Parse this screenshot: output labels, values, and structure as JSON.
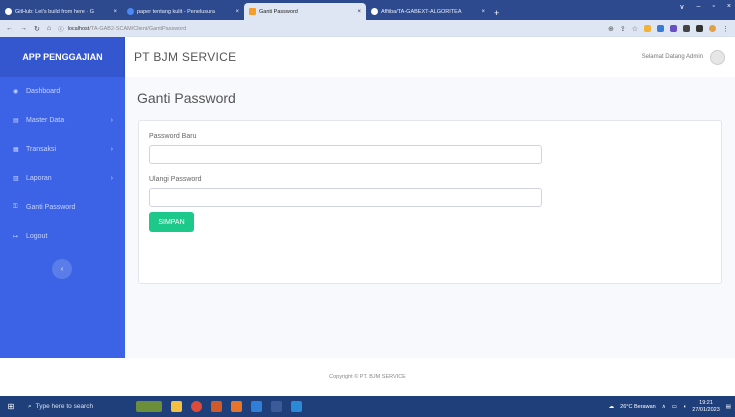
{
  "browser": {
    "tabs": [
      {
        "title": "GitHub: Let's build from here · G",
        "color": "#ffffff"
      },
      {
        "title": "paper tentang kulit - Penelusura",
        "color": "#4a8af4"
      },
      {
        "title": "Ganti Password",
        "color": "#f59e2b"
      },
      {
        "title": "Affiiba/TA-GABEXT-ALGORITEA",
        "color": "#ffffff"
      }
    ],
    "tab_close": "×",
    "new_tab": "+",
    "window_controls": [
      "∨",
      "–",
      "▫",
      "×"
    ],
    "url_host": "localhost",
    "url_path": "/TA-GAB2-SCAM/Client/GantiPassword"
  },
  "sidebar": {
    "brand": "APP PENGGAJIAN",
    "items": [
      {
        "label": "Dashboard",
        "icon": "◉",
        "chevron": ""
      },
      {
        "label": "Master Data",
        "icon": "▤",
        "chevron": "›"
      },
      {
        "label": "Transaksi",
        "icon": "▦",
        "chevron": "›"
      },
      {
        "label": "Laporan",
        "icon": "▥",
        "chevron": "›"
      },
      {
        "label": "Ganti Password",
        "icon": "⚿",
        "chevron": ""
      },
      {
        "label": "Logout",
        "icon": "↦",
        "chevron": ""
      }
    ],
    "toggle": "‹"
  },
  "topbar": {
    "company": "PT BJM SERVICE",
    "welcome": "Selamat Datang Admin"
  },
  "main": {
    "title": "Ganti Password",
    "form": {
      "new_password_label": "Password Baru",
      "confirm_password_label": "Ulangi Password",
      "save_label": "SIMPAN"
    }
  },
  "footer": {
    "text": "Copyright © PT. BJM SERVICE"
  },
  "taskbar": {
    "search_placeholder": "Type here to search",
    "weather": "26°C Berawan",
    "time": "19:21",
    "date": "27/01/2023"
  },
  "colors": {
    "sidebar_bg": "#3c63e5",
    "brand_bg": "#3456cf",
    "save_button": "#1cc88a"
  }
}
